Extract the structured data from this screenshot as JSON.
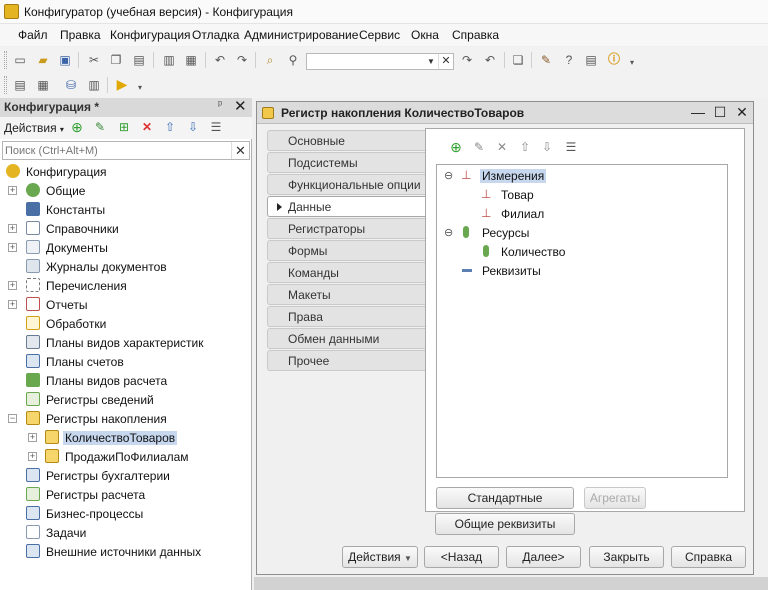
{
  "window": {
    "title": "Конфигуратор (учебная версия) - Конфигурация"
  },
  "menu": [
    "Файл",
    "Правка",
    "Конфигурация",
    "Отладка",
    "Администрирование",
    "Сервис",
    "Окна",
    "Справка"
  ],
  "toolbar": {
    "search_value": ""
  },
  "config_panel": {
    "title": "Конфигурация",
    "modified_mark": "*",
    "pin_icon": "pin-icon",
    "close_icon": "close-icon",
    "actions_label": "Действия",
    "search_placeholder": "Поиск (Ctrl+Alt+M)",
    "tree": [
      {
        "label": "Конфигурация",
        "icon": "config-root-icon",
        "color": "#e5b422"
      },
      {
        "label": "Общие",
        "icon": "common-icon",
        "color": "#6aa84f"
      },
      {
        "label": "Константы",
        "icon": "constants-icon",
        "color": "#4a6fa5"
      },
      {
        "label": "Справочники",
        "icon": "catalogs-icon",
        "color": "#7a8aa0"
      },
      {
        "label": "Документы",
        "icon": "documents-icon",
        "color": "#8a9bb0"
      },
      {
        "label": "Журналы документов",
        "icon": "document-journals-icon",
        "color": "#8a9bb0"
      },
      {
        "label": "Перечисления",
        "icon": "enums-icon",
        "color": "#7a7a7a"
      },
      {
        "label": "Отчеты",
        "icon": "reports-icon",
        "color": "#c0504d"
      },
      {
        "label": "Обработки",
        "icon": "data-processors-icon",
        "color": "#d4a017"
      },
      {
        "label": "Планы видов характеристик",
        "icon": "chart-of-characteristic-types-icon",
        "color": "#6a7a90"
      },
      {
        "label": "Планы счетов",
        "icon": "chart-of-accounts-icon",
        "color": "#4a6fa5"
      },
      {
        "label": "Планы видов расчета",
        "icon": "chart-of-calculation-types-icon",
        "color": "#6aa84f"
      },
      {
        "label": "Регистры сведений",
        "icon": "information-registers-icon",
        "color": "#6aa84f"
      },
      {
        "label": "Регистры накопления",
        "icon": "accumulation-registers-icon",
        "color": "#e5b422"
      },
      {
        "label": "КоличествоТоваров",
        "icon": "accumulation-register-icon",
        "color": "#e5b422"
      },
      {
        "label": "ПродажиПоФилиалам",
        "icon": "accumulation-register-icon",
        "color": "#e5b422"
      },
      {
        "label": "Регистры бухгалтерии",
        "icon": "accounting-registers-icon",
        "color": "#4a6fa5"
      },
      {
        "label": "Регистры расчета",
        "icon": "calculation-registers-icon",
        "color": "#6aa84f"
      },
      {
        "label": "Бизнес-процессы",
        "icon": "business-processes-icon",
        "color": "#4a6fa5"
      },
      {
        "label": "Задачи",
        "icon": "tasks-icon",
        "color": "#8a9bb0"
      },
      {
        "label": "Внешние источники данных",
        "icon": "external-data-sources-icon",
        "color": "#4a6fa5"
      }
    ]
  },
  "register_window": {
    "title": "Регистр накопления КоличествоТоваров",
    "tabs": [
      "Основные",
      "Подсистемы",
      "Функциональные опции",
      "Данные",
      "Регистраторы",
      "Формы",
      "Команды",
      "Макеты",
      "Права",
      "Обмен данными",
      "Прочее"
    ],
    "active_tab": "Данные",
    "data_tree": [
      {
        "label": "Измерения",
        "icon": "dimensions-icon"
      },
      {
        "label": "Товар",
        "icon": "dimension-icon"
      },
      {
        "label": "Филиал",
        "icon": "dimension-icon"
      },
      {
        "label": "Ресурсы",
        "icon": "resources-icon"
      },
      {
        "label": "Количество",
        "icon": "resource-icon"
      },
      {
        "label": "Реквизиты",
        "icon": "attributes-icon"
      }
    ],
    "buttons": {
      "standard_attributes": "Стандартные реквизиты",
      "aggregates": "Агрегаты",
      "common_attributes": "Общие реквизиты"
    },
    "footer": {
      "actions": "Действия",
      "back": "<Назад",
      "next": "Далее>",
      "close": "Закрыть",
      "help": "Справка"
    }
  }
}
